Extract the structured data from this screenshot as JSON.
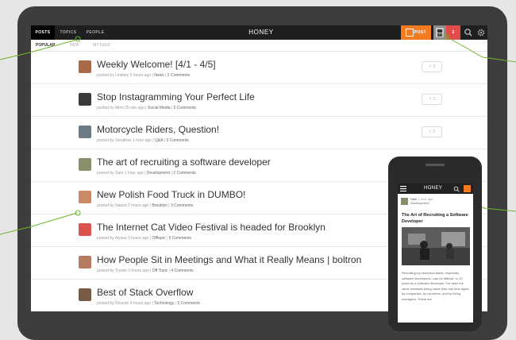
{
  "app": {
    "tabs": [
      "POSTS",
      "TOPICS",
      "PEOPLE"
    ],
    "logo": "HONEY",
    "post_label": "POST",
    "notification_count": "3",
    "brand_color": "#f47b20",
    "notification_color": "#e34a4a"
  },
  "subnav": [
    "POPULAR",
    "NEW",
    "MY FEED"
  ],
  "feed": [
    {
      "title": "Weekly Welcome! [4/1 - 4/5]",
      "author": "Lindsey",
      "time": "5 hours ago",
      "category": "News",
      "comments": "2 Comments",
      "votes": "3"
    },
    {
      "title": "Stop Instagramming Your Perfect Life",
      "author": "Mimi",
      "time": "25 min ago",
      "category": "Social Media",
      "comments": "0 Comments",
      "votes": "2"
    },
    {
      "title": "Motorcycle Riders, Question!",
      "author": "Jonathan",
      "time": "1 hour ago",
      "category": "Q&A",
      "comments": "3 Comments",
      "votes": "2"
    },
    {
      "title": "The art of recruiting a software developer",
      "author": "Sam",
      "time": "1 hour ago",
      "category": "Development",
      "comments": "2 Comments",
      "votes": ""
    },
    {
      "title": "New Polish Food Truck in DUMBO!",
      "author": "Naomi",
      "time": "2 hours ago",
      "category": "Brooklyn",
      "comments": "3 Comments",
      "votes": ""
    },
    {
      "title": "The Internet Cat Video Festival is headed for Brooklyn",
      "author": "Alyssa",
      "time": "3 hours ago",
      "category": "Offtopic",
      "comments": "5 Comments",
      "votes": ""
    },
    {
      "title": "How People Sit in Meetings and What it Really Means | boltron",
      "author": "Trystin",
      "time": "3 hours ago",
      "category": "Off Topic",
      "comments": "4 Comments",
      "votes": ""
    },
    {
      "title": "Best of Stack Overflow",
      "author": "Ricardo",
      "time": "4 hours ago",
      "category": "Technology",
      "comments": "5 Comments",
      "votes": ""
    }
  ],
  "meta_prefix": "posted by",
  "phone": {
    "logo": "HONEY",
    "author": "Sam",
    "author_time": "1 hour ago",
    "author_category": "Development",
    "title": "The Art of Recruiting a Software Developer",
    "body": "Recruiting top technical talent, especially software developers—can be difficult. In 10 years as a software developer, I've seen the same mistakes being made time and time again by companies, by recruiters, and by hiring managers. These are"
  }
}
